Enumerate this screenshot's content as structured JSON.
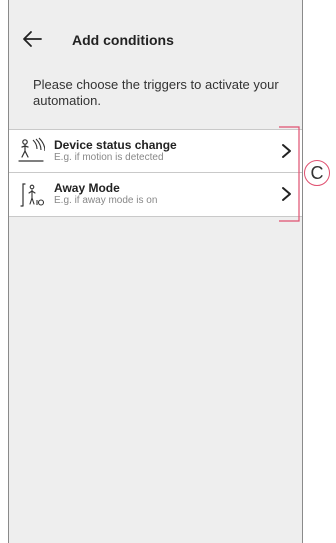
{
  "header": {
    "title": "Add conditions"
  },
  "intro": {
    "text": "Please choose the triggers to activate your automation."
  },
  "triggers": [
    {
      "name": "Device status change",
      "description": "E.g. if motion is detected",
      "icon": "motion-sensor-icon"
    },
    {
      "name": "Away Mode",
      "description": "E.g. if away mode is on",
      "icon": "away-mode-icon"
    }
  ],
  "annotation": {
    "label": "C",
    "color": "#e05070"
  }
}
